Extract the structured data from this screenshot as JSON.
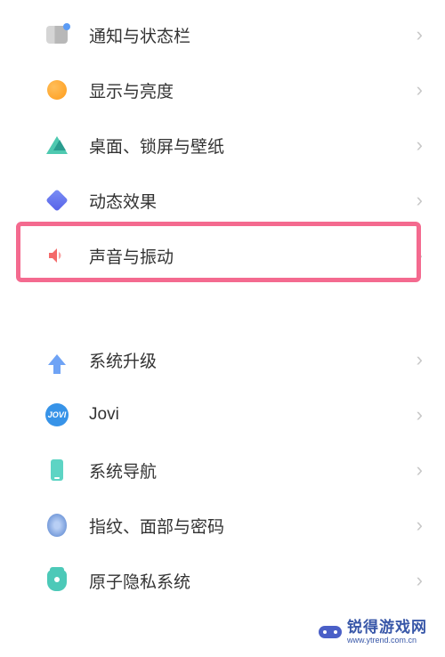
{
  "settings": {
    "group1": [
      {
        "id": "notification",
        "label": "通知与状态栏",
        "icon": "notification-icon"
      },
      {
        "id": "display",
        "label": "显示与亮度",
        "icon": "display-icon"
      },
      {
        "id": "wallpaper",
        "label": "桌面、锁屏与壁纸",
        "icon": "wallpaper-icon"
      },
      {
        "id": "animation",
        "label": "动态效果",
        "icon": "animation-icon"
      },
      {
        "id": "sound",
        "label": "声音与振动",
        "icon": "sound-icon"
      }
    ],
    "group2": [
      {
        "id": "upgrade",
        "label": "系统升级",
        "icon": "upgrade-icon"
      },
      {
        "id": "jovi",
        "label": "Jovi",
        "icon": "jovi-icon"
      },
      {
        "id": "navigation",
        "label": "系统导航",
        "icon": "navigation-icon"
      },
      {
        "id": "fingerprint",
        "label": "指纹、面部与密码",
        "icon": "fingerprint-icon"
      },
      {
        "id": "privacy",
        "label": "原子隐私系统",
        "icon": "privacy-icon"
      }
    ]
  },
  "highlighted_item": "sound",
  "watermark": {
    "title": "锐得游戏网",
    "subtitle": "www.ytrend.com.cn"
  },
  "jovi_badge_text": "JOVI"
}
